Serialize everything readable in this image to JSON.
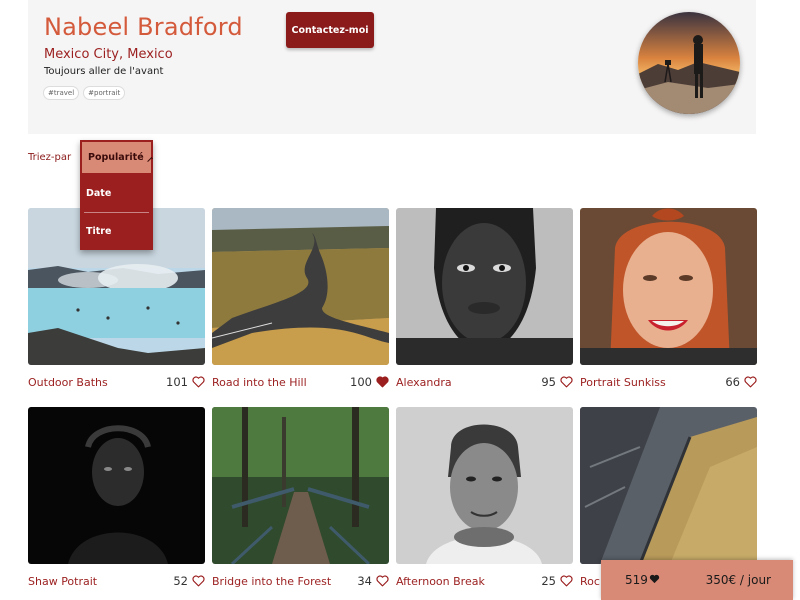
{
  "profile": {
    "name": "Nabeel Bradford",
    "location": "Mexico City, Mexico",
    "tagline": "Toujours aller de l'avant",
    "tags": [
      "#travel",
      "#portrait"
    ],
    "contact_label": "Contactez-moi"
  },
  "sort": {
    "label": "Triez-par",
    "selected": "Popularité",
    "options": [
      "Date",
      "Titre"
    ]
  },
  "gallery": [
    {
      "title": "Outdoor Baths",
      "likes": "101",
      "liked": false
    },
    {
      "title": "Road into the Hill",
      "likes": "100",
      "liked": true
    },
    {
      "title": "Alexandra",
      "likes": "95",
      "liked": false
    },
    {
      "title": "Portrait Sunkiss",
      "likes": "66",
      "liked": false
    },
    {
      "title": "Shaw Potrait",
      "likes": "52",
      "liked": false
    },
    {
      "title": "Bridge into the Forest",
      "likes": "34",
      "liked": false
    },
    {
      "title": "Afternoon Break",
      "likes": "25",
      "liked": false
    },
    {
      "title": "Roc",
      "likes": "",
      "liked": false
    }
  ],
  "summary": {
    "total_likes": "519",
    "price": "350€ / jour"
  },
  "colors": {
    "accent": "#9b1f1f",
    "name": "#d45a3c",
    "highlight": "#d98a76"
  }
}
